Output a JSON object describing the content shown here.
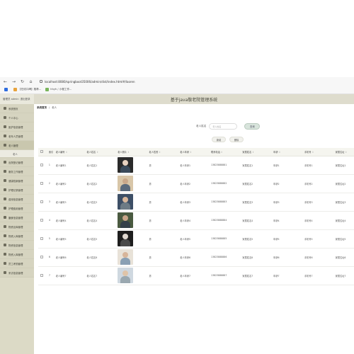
{
  "browser": {
    "back": "←",
    "forward": "→",
    "reload": "↻",
    "home": "⌂",
    "url": "localhost:8080/springboot35006/admin/dist/index.html#/laoren",
    "bookmarks": [
      {
        "label": "",
        "color": "#2d6cdf"
      },
      {
        "label": "【在线口碑】推荐...",
        "color": "#e8a33c"
      },
      {
        "label": "hhyh / 小程工作...",
        "color": "#7ab55c"
      }
    ]
  },
  "header": {
    "title": "基于java敬老院管理系统",
    "user_label": "管理员 admin",
    "logout_label": "退出登录"
  },
  "sidebar": {
    "items": [
      {
        "label": "系统首页",
        "sub": false
      },
      {
        "label": "个人中心",
        "sub": false
      },
      {
        "label": "医护信息管理",
        "sub": false
      },
      {
        "label": "老年人员管理",
        "sub": false
      },
      {
        "label": "老人管理",
        "sub": false,
        "active": true
      },
      {
        "label": "老人",
        "sub": true
      },
      {
        "label": "出院登记管理",
        "sub": false
      },
      {
        "label": "服务工作管理",
        "sub": false
      },
      {
        "label": "健康档案管理",
        "sub": false
      },
      {
        "label": "护理记录管理",
        "sub": false
      },
      {
        "label": "费用信息管理",
        "sub": false
      },
      {
        "label": "护理费用管理",
        "sub": false
      },
      {
        "label": "膳食信息管理",
        "sub": false
      },
      {
        "label": "物资出库管理",
        "sub": false
      },
      {
        "label": "物资入库管理",
        "sub": false
      },
      {
        "label": "物资信息管理",
        "sub": false
      },
      {
        "label": "物资入库管理",
        "sub": false
      },
      {
        "label": "员工考勤管理",
        "sub": false
      },
      {
        "label": "来访信息管理",
        "sub": false
      }
    ]
  },
  "breadcrumb": {
    "home": "系统首页",
    "sep": "/",
    "current": "老人"
  },
  "search": {
    "label": "老人姓名",
    "placeholder": "老人姓名",
    "button": "查询"
  },
  "actions": {
    "add": "新增",
    "delete": "删除"
  },
  "table": {
    "headers": [
      "",
      "索引",
      "老人编号",
      "老人姓名",
      "老人照片",
      "老人性别",
      "老人年龄",
      "联系电话",
      "家属姓名",
      "年龄",
      "手机号",
      "家属住址"
    ],
    "rows": [
      {
        "index": "1",
        "no": "老人编号1",
        "name": "老人姓名1",
        "gender": "男",
        "age": "老人年龄1",
        "phone": "13823888881",
        "family": "家属姓名1",
        "fage": "年龄1",
        "mobile": "手机号1",
        "addr": "家属住址1",
        "photo": {
          "bg": "#2a2a2a",
          "head": "#e8d2c0",
          "body": "#3a4a5a"
        }
      },
      {
        "index": "2",
        "no": "老人编号2",
        "name": "老人姓名2",
        "gender": "男",
        "age": "老人年龄2",
        "phone": "13823888882",
        "family": "家属姓名2",
        "fage": "年龄2",
        "mobile": "手机号2",
        "addr": "家属住址2",
        "photo": {
          "bg": "#d8c6a8",
          "head": "#c9a88a",
          "body": "#5b6b7c"
        }
      },
      {
        "index": "3",
        "no": "老人编号3",
        "name": "老人姓名3",
        "gender": "男",
        "age": "老人年龄3",
        "phone": "13823888883",
        "family": "家属姓名3",
        "fage": "年龄3",
        "mobile": "手机号3",
        "addr": "家属住址3",
        "photo": {
          "bg": "#3d4f66",
          "head": "#d8b79c",
          "body": "#6d7b85"
        }
      },
      {
        "index": "4",
        "no": "老人编号4",
        "name": "老人姓名4",
        "gender": "男",
        "age": "老人年龄4",
        "phone": "13823888884",
        "family": "家属姓名4",
        "fage": "年龄4",
        "mobile": "手机号4",
        "addr": "家属住址4",
        "photo": {
          "bg": "#4a5a40",
          "head": "#c8a488",
          "body": "#34404a"
        }
      },
      {
        "index": "5",
        "no": "老人编号5",
        "name": "老人姓名5",
        "gender": "男",
        "age": "老人年龄5",
        "phone": "13823888885",
        "family": "家属姓名5",
        "fage": "年龄5",
        "mobile": "手机号5",
        "addr": "家属住址5",
        "photo": {
          "bg": "#1e1e1e",
          "head": "#e0d8d0",
          "body": "#4a4a4a"
        }
      },
      {
        "index": "6",
        "no": "老人编号6",
        "name": "老人姓名6",
        "gender": "男",
        "age": "老人年龄6",
        "phone": "13823888886",
        "family": "家属姓名6",
        "fage": "年龄6",
        "mobile": "手机号6",
        "addr": "家属住址6",
        "photo": {
          "bg": "#e8e2d8",
          "head": "#d7b59a",
          "body": "#8aa0b4"
        }
      },
      {
        "index": "7",
        "no": "老人编号7",
        "name": "老人姓名7",
        "gender": "男",
        "age": "老人年龄7",
        "phone": "13823888887",
        "family": "家属姓名7",
        "fage": "年龄7",
        "mobile": "手机号7",
        "addr": "家属住址7",
        "photo": {
          "bg": "#cfd8e0",
          "head": "#e0c4a8",
          "body": "#9aa8b0"
        }
      }
    ]
  }
}
